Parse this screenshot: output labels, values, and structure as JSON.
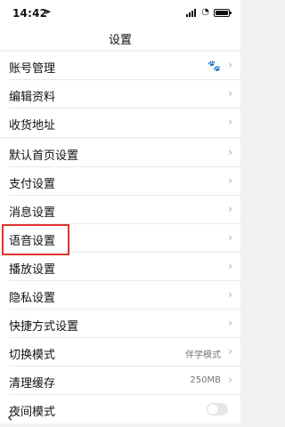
{
  "status": {
    "time": "14:42",
    "location_icon": "location-arrow-icon",
    "signal_icon": "signal-icon",
    "wifi_icon": "wifi-icon",
    "battery_icon": "battery-icon",
    "battery_fill": 0.85
  },
  "nav": {
    "title": "设置",
    "back_icon": "back-icon"
  },
  "groups": [
    {
      "items": [
        {
          "label": "账号管理",
          "value": "",
          "icon": "paw-icon"
        },
        {
          "label": "编辑资料"
        },
        {
          "label": "收货地址"
        }
      ]
    },
    {
      "items": [
        {
          "label": "默认首页设置"
        },
        {
          "label": "支付设置"
        },
        {
          "label": "消息设置"
        },
        {
          "label": "语音设置",
          "highlighted": true
        },
        {
          "label": "播放设置"
        },
        {
          "label": "隐私设置"
        },
        {
          "label": "快捷方式设置"
        },
        {
          "label": "切换模式",
          "value": "伴学模式"
        },
        {
          "label": "清理缓存",
          "value": "250MB"
        },
        {
          "label": "夜间模式",
          "toggle": false
        }
      ]
    }
  ],
  "colors": {
    "highlight": "#e0332f",
    "background": "#f2f2f2"
  }
}
